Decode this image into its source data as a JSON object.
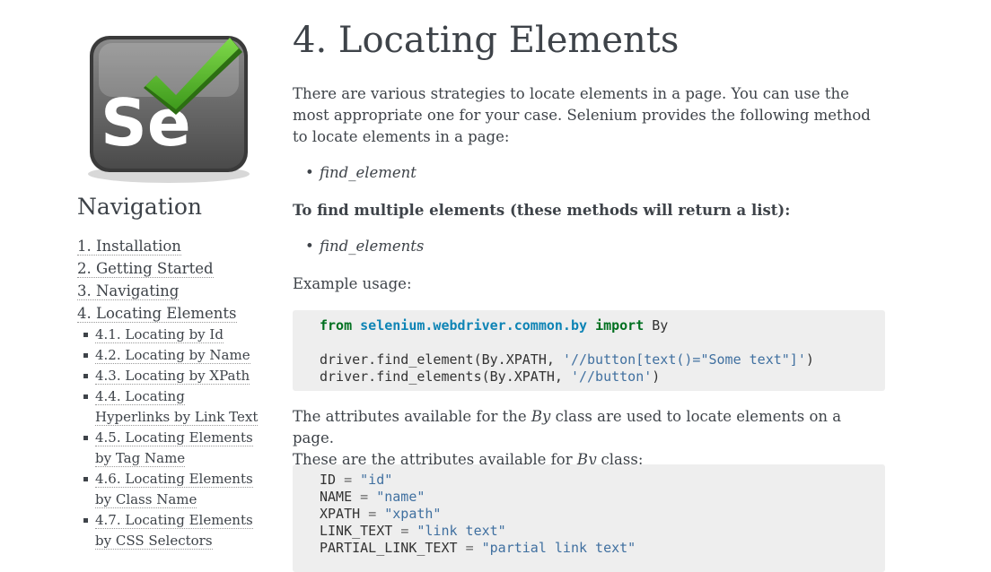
{
  "sidebar": {
    "nav_title": "Navigation",
    "toc": [
      {
        "label": "1. Installation"
      },
      {
        "label": "2. Getting Started"
      },
      {
        "label": "3. Navigating"
      },
      {
        "label": "4. Locating Elements"
      }
    ],
    "sub": [
      {
        "label": "4.1. Locating by Id"
      },
      {
        "label": "4.2. Locating by Name"
      },
      {
        "label": "4.3. Locating by XPath"
      },
      {
        "label": "4.4. Locating Hyperlinks by Link Text"
      },
      {
        "label": "4.5. Locating Elements by Tag Name"
      },
      {
        "label": "4.6. Locating Elements by Class Name"
      },
      {
        "label": "4.7. Locating Elements by CSS Selectors"
      }
    ]
  },
  "main": {
    "title": "4. Locating Elements",
    "intro": "There are various strategies to locate elements in a page. You can use the most appropriate one for your case. Selenium provides the following method to locate elements in a page:",
    "bullet1": "find_element",
    "multiple_heading": "To find multiple elements (these methods will return a list):",
    "bullet2": "find_elements",
    "example_usage": "Example usage:",
    "code1": {
      "kw_from": "from",
      "module": "selenium.webdriver.common.by",
      "kw_import": "import",
      "name": "By",
      "line2_a": "driver.find_element(By.XPATH, ",
      "line2_str": "'//button[text()=\"Some text\"]'",
      "line2_b": ")",
      "line3_a": "driver.find_elements(By.XPATH, ",
      "line3_str": "'//button'",
      "line3_b": ")"
    },
    "attrs_p1": "The attributes available for the ",
    "attrs_by1": "By",
    "attrs_p2": " class are used to locate elements on a page.",
    "attrs_p3": "These are the attributes available for ",
    "attrs_by2": "By",
    "attrs_p4": " class:",
    "code2": [
      {
        "name": "ID",
        "value": "\"id\""
      },
      {
        "name": "NAME",
        "value": "\"name\""
      },
      {
        "name": "XPATH",
        "value": "\"xpath\""
      },
      {
        "name": "LINK_TEXT",
        "value": "\"link text\""
      },
      {
        "name": "PARTIAL_LINK_TEXT",
        "value": "\"partial link text\""
      }
    ]
  },
  "logo": {
    "text": "Se",
    "colors": {
      "box": "#6f6f6f",
      "check": "#5cb82e",
      "text": "#ffffff"
    }
  }
}
